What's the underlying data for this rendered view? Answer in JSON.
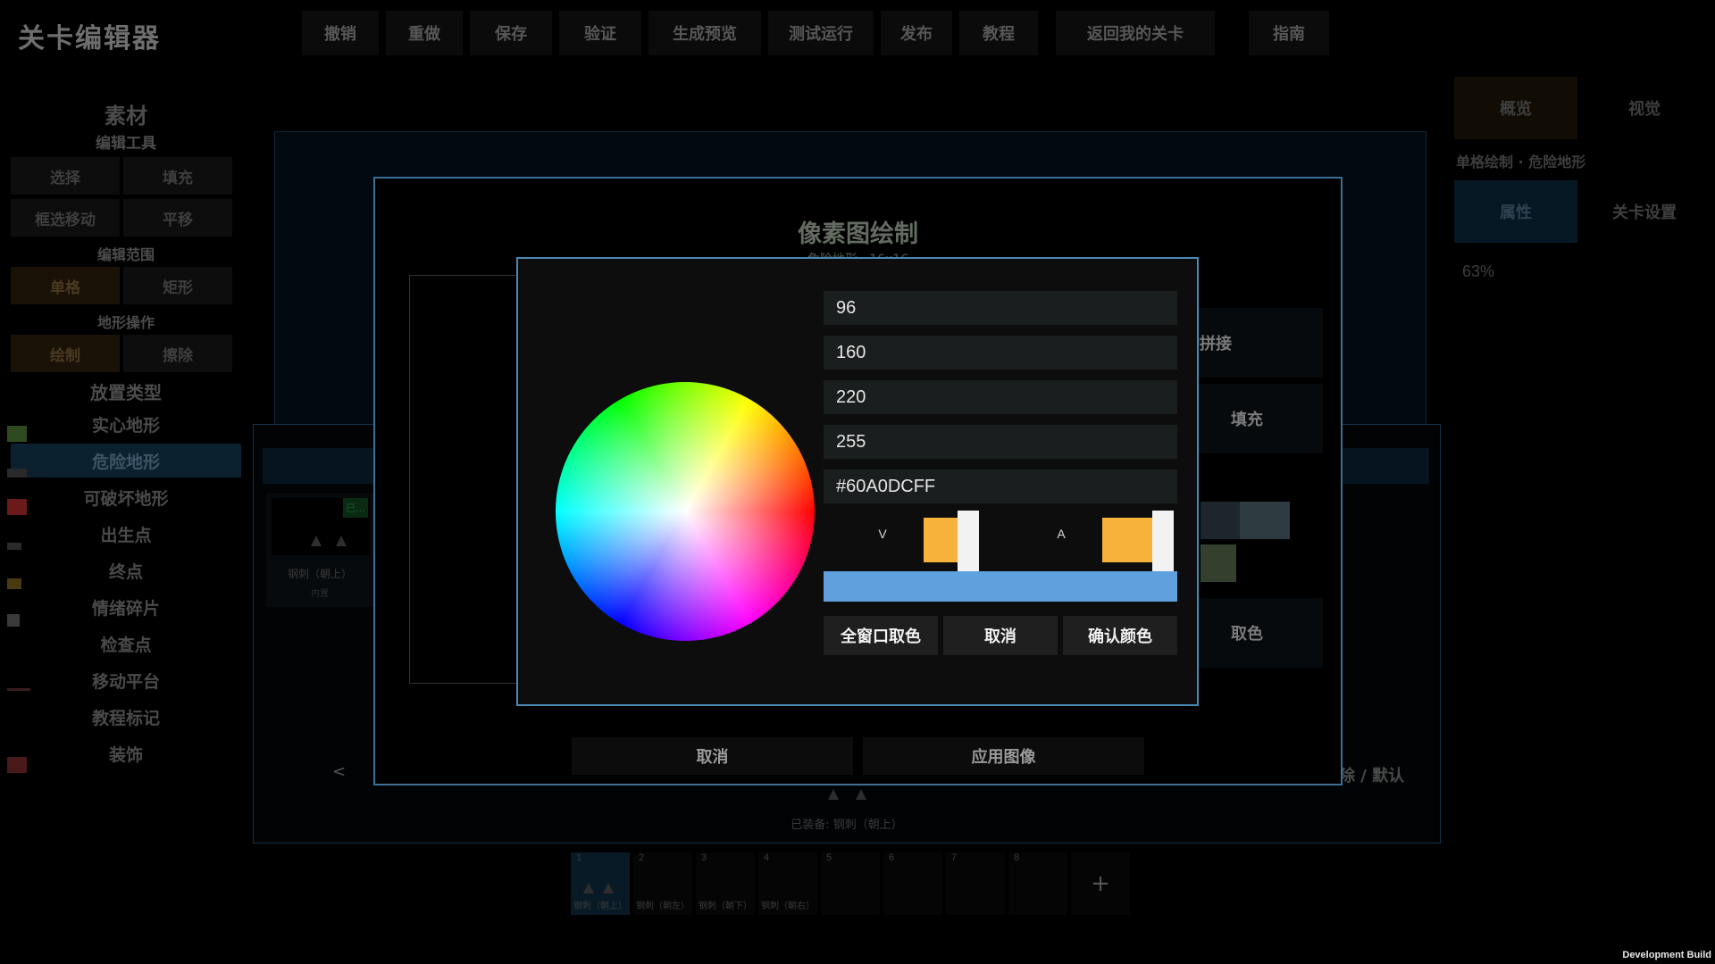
{
  "app": {
    "title": "关卡编辑器"
  },
  "toolbar": [
    {
      "name": "undo-button",
      "label": "撤销"
    },
    {
      "name": "redo-button",
      "label": "重做"
    },
    {
      "name": "save-button",
      "label": "保存"
    },
    {
      "name": "validate-button",
      "label": "验证"
    },
    {
      "name": "generate-preview-button",
      "label": "生成预览"
    },
    {
      "name": "test-run-button",
      "label": "测试运行"
    },
    {
      "name": "publish-button",
      "label": "发布"
    },
    {
      "name": "tutorial-button",
      "label": "教程"
    },
    {
      "name": "back-to-my-levels-button",
      "label": "返回我的关卡"
    },
    {
      "name": "guide-button",
      "label": "指南"
    }
  ],
  "sidebar": {
    "title": "素材",
    "edit_tools_heading": "编辑工具",
    "tool_select": "选择",
    "tool_fill": "填充",
    "tool_box_move": "框选移动",
    "tool_pan": "平移",
    "edit_range_heading": "编辑范围",
    "range_single": "单格",
    "range_rect": "矩形",
    "terrain_ops_heading": "地形操作",
    "op_draw": "绘制",
    "op_erase": "擦除",
    "placement_heading": "放置类型",
    "placement_items": [
      "实心地形",
      "危险地形",
      "可破坏地形",
      "出生点",
      "终点",
      "情绪碎片",
      "检查点",
      "移动平台",
      "教程标记",
      "装饰"
    ]
  },
  "right_panel": {
    "tab_overview": "概览",
    "tab_visual": "视觉",
    "breadcrumb": "单格绘制 · 危险地形",
    "tab_properties": "属性",
    "tab_level_settings": "关卡设置",
    "zoom": "63%"
  },
  "asset_panel": {
    "tag": "已…",
    "card_caption": "钢刺（朝上）",
    "card_sub": "内置",
    "prev_page": "<",
    "reset_label": "除 / 默认",
    "equipped": "已装备: 钢刺（朝上）"
  },
  "pixel_editor": {
    "title": "像素图绘制",
    "subtitle": "危险地形 · 16x16",
    "auto_tile": "动拼接",
    "fill": "填充",
    "pick_color": "取色",
    "cancel": "取消",
    "apply": "应用图像"
  },
  "color_picker": {
    "r": "96",
    "g": "160",
    "b": "220",
    "a": "255",
    "hex": "#60A0DCFF",
    "v_label": "V",
    "a_label": "A",
    "v_level": 0.78,
    "a_level": 1.0,
    "preview_color": "#60A0DC",
    "window_pick": "全窗口取色",
    "cancel": "取消",
    "confirm": "确认颜色"
  },
  "hotbar": {
    "slots": [
      {
        "num": "1",
        "caption": "钢刺（朝上）"
      },
      {
        "num": "2",
        "caption": "钢刺（朝左）"
      },
      {
        "num": "3",
        "caption": "钢刺（朝下）"
      },
      {
        "num": "4",
        "caption": "钢刺（朝右）"
      },
      {
        "num": "5",
        "caption": ""
      },
      {
        "num": "6",
        "caption": ""
      },
      {
        "num": "7",
        "caption": ""
      },
      {
        "num": "8",
        "caption": ""
      }
    ],
    "add": "+"
  },
  "footer": {
    "build": "Development Build"
  },
  "colors": {
    "accent_border": "#4a88b5",
    "slider_fill": "#f7b23b",
    "selected_blue": "#0c2130"
  }
}
